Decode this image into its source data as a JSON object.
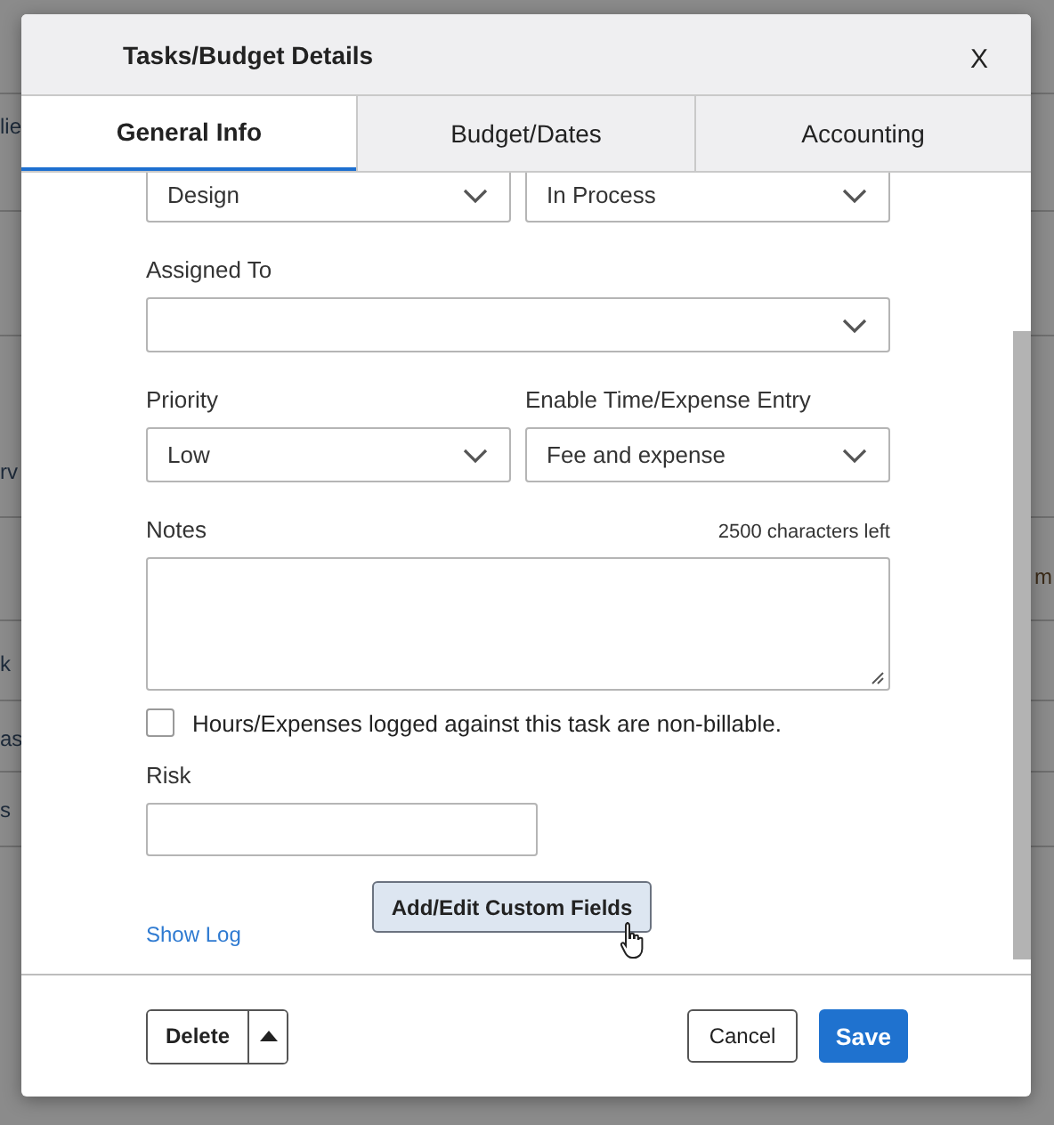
{
  "background": {
    "left_fragments": [
      "lie",
      "rv",
      "k",
      "as",
      "s"
    ],
    "right_fragments": [
      "m"
    ]
  },
  "dialog": {
    "title": "Tasks/Budget Details",
    "close": "X"
  },
  "tabs": [
    {
      "label": "General Info",
      "selected": true
    },
    {
      "label": "Budget/Dates",
      "selected": false
    },
    {
      "label": "Accounting",
      "selected": false
    }
  ],
  "form": {
    "category": {
      "value": "Design"
    },
    "status": {
      "value": "In Process"
    },
    "assigned_to": {
      "label": "Assigned To"
    },
    "priority": {
      "label": "Priority",
      "value": "Low"
    },
    "time_expense": {
      "label": "Enable Time/Expense Entry",
      "value": "Fee and expense"
    },
    "notes": {
      "label": "Notes",
      "counter": "2500 characters left"
    },
    "non_billable": {
      "label": "Hours/Expenses logged against this task are non-billable.",
      "checked": false
    },
    "risk": {
      "label": "Risk"
    },
    "custom_fields_button": "Add/Edit Custom Fields",
    "show_log": "Show Log"
  },
  "footer": {
    "delete": "Delete",
    "cancel": "Cancel",
    "save": "Save"
  }
}
